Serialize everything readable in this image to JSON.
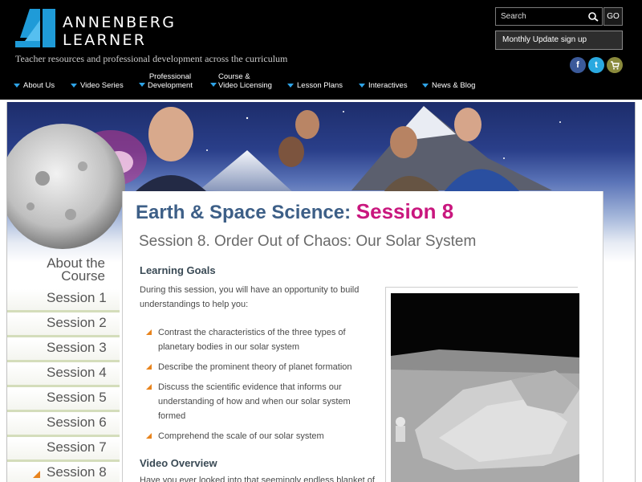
{
  "brand": {
    "name_line1": "ANNENBERG",
    "name_line2": "LEARNER",
    "tagline": "Teacher resources and professional development across the curriculum"
  },
  "search": {
    "placeholder": "Search",
    "go_label": "GO"
  },
  "monthly_update_label": "Monthly Update sign up",
  "social": {
    "facebook": "f",
    "twitter": "t",
    "cart": "cart-icon"
  },
  "nav": {
    "about": "About Us",
    "video_series": "Video Series",
    "professional_line1": "Professional",
    "professional_line2": "Development",
    "course_line1": "Course &",
    "course_line2": "Video Licensing",
    "lesson_plans": "Lesson Plans",
    "interactives": "Interactives",
    "news": "News & Blog"
  },
  "colors": {
    "nav_caret": "#2ea3e6",
    "course_title": "#3d5f87",
    "session_accent": "#c9177e",
    "bullet": "#e8841d"
  },
  "sidebar": {
    "about": "About the Course",
    "items": [
      {
        "label": "Session 1"
      },
      {
        "label": "Session 2"
      },
      {
        "label": "Session 3"
      },
      {
        "label": "Session 4"
      },
      {
        "label": "Session 5"
      },
      {
        "label": "Session 6"
      },
      {
        "label": "Session 7"
      },
      {
        "label": "Session 8",
        "active": true
      }
    ]
  },
  "content": {
    "course_title": "Earth & Space Science:",
    "course_session": "Session 8",
    "session_title": "Session 8. Order Out of Chaos: Our Solar System",
    "goals_heading": "Learning Goals",
    "goals_intro": "During this session, you will have an opportunity to build understandings to help you:",
    "goals": [
      "Contrast the characteristics of the three types of planetary bodies in our solar system",
      "Describe the prominent theory of planet formation",
      "Discuss the scientific evidence that informs our understanding of how and when our solar system formed",
      "Comprehend the scale of our solar system"
    ],
    "video_heading": "Video Overview",
    "video_text": "Have you ever looked into that seemingly endless blanket of"
  }
}
